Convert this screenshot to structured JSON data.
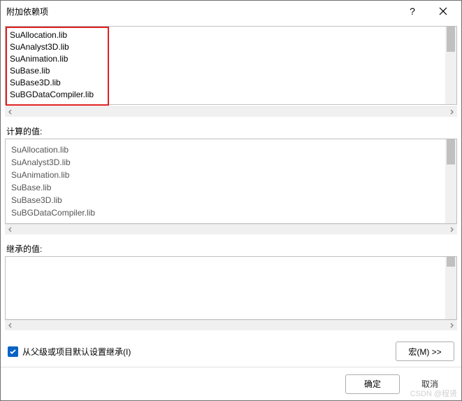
{
  "titlebar": {
    "title": "附加依赖项"
  },
  "editor": {
    "lines": "SuAllocation.lib\nSuAnalyst3D.lib\nSuAnimation.lib\nSuBase.lib\nSuBase3D.lib\nSuBGDataCompiler.lib"
  },
  "computed": {
    "label": "计算的值:",
    "lines": "SuAllocation.lib\nSuAnalyst3D.lib\nSuAnimation.lib\nSuBase.lib\nSuBase3D.lib\nSuBGDataCompiler.lib"
  },
  "inherited": {
    "label": "继承的值:",
    "lines": ""
  },
  "inherit_checkbox": {
    "checked": true,
    "label": "从父级或项目默认设置继承(I)"
  },
  "macro_button": {
    "label": "宏(M) >>"
  },
  "dialog_buttons": {
    "ok": "确定",
    "cancel": "取消"
  },
  "watermark": "CSDN @程贤"
}
